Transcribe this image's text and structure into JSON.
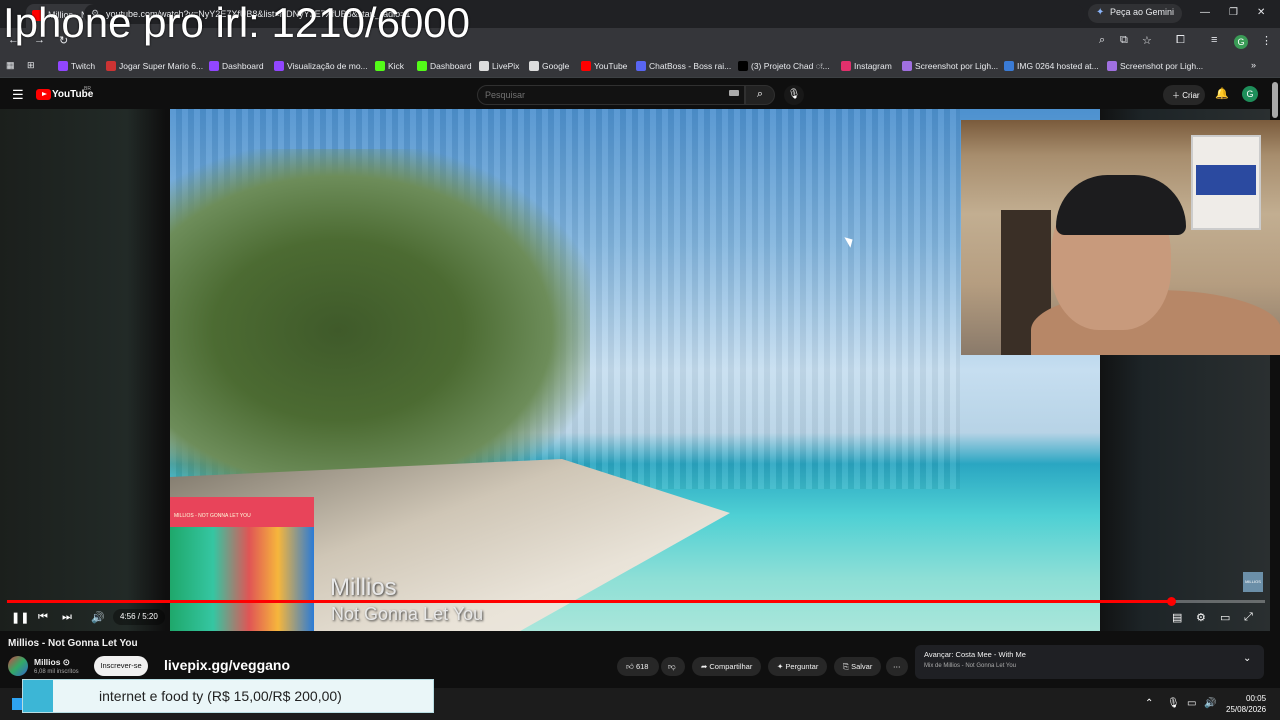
{
  "overlay": {
    "title": "Iphone pro irl: 1210/6000"
  },
  "browser": {
    "tab_title": "Millios - Not Gonna Let You",
    "gemini_label": "Peça ao Gemini",
    "url": "youtube.com/watch?v=NyY2E7XfUB8&list=RDNyY2E7XfUB8&start_radio=1",
    "profile_initial": "G",
    "bookmarks": [
      {
        "label": "Twitch",
        "color": "#9146ff"
      },
      {
        "label": "Jogar Super Mario 6...",
        "color": "#cc3333"
      },
      {
        "label": "Dashboard",
        "color": "#9146ff"
      },
      {
        "label": "Visualização de mo...",
        "color": "#9146ff"
      },
      {
        "label": "Kick",
        "color": "#53fc18"
      },
      {
        "label": "Dashboard",
        "color": "#53fc18"
      },
      {
        "label": "LivePix",
        "color": "#dddddd"
      },
      {
        "label": "Google",
        "color": "#dddddd"
      },
      {
        "label": "YouTube",
        "color": "#ff0000"
      },
      {
        "label": "ChatBoss - Boss rai...",
        "color": "#5865f2"
      },
      {
        "label": "(3) Projeto Chad ः...",
        "color": "#000000"
      },
      {
        "label": "Instagram",
        "color": "#e1306c"
      },
      {
        "label": "Screenshot por Ligh...",
        "color": "#a070e0"
      },
      {
        "label": "IMG 0264 hosted at...",
        "color": "#3a7bd5"
      },
      {
        "label": "Screenshot por Ligh...",
        "color": "#a070e0"
      }
    ]
  },
  "youtube": {
    "logo_text": "YouTube",
    "region": "BR",
    "search_placeholder": "Pesquisar",
    "create_label": "Criar",
    "avatar_initial": "G"
  },
  "video": {
    "artist": "Millios",
    "song": "Not Gonna Let You",
    "mini_card_text": "MILLIOS - NOT GONNA LET YOU",
    "corner_logo_text": "MILLIOS",
    "time": "4:56 / 5:20",
    "progress": 0.925
  },
  "below": {
    "title": "Millios - Not Gonna Let You",
    "channel": "Millios ⊙",
    "subs": "6,08 mil inscritos",
    "subscribe": "Inscrever-se",
    "livepix": "livepix.gg/veggano",
    "likes": "618",
    "share": "Compartilhar",
    "ask": "Perguntar",
    "save": "Salvar",
    "next_label": "Avançar: Costa Mee - With Me",
    "next_sub": "Mix de Millios - Not Gonna Let You"
  },
  "donation": {
    "text": "internet e food ty (R$ 15,00/R$ 200,00)"
  },
  "taskbar": {
    "time": "00:05",
    "date": "25/08/2026"
  }
}
